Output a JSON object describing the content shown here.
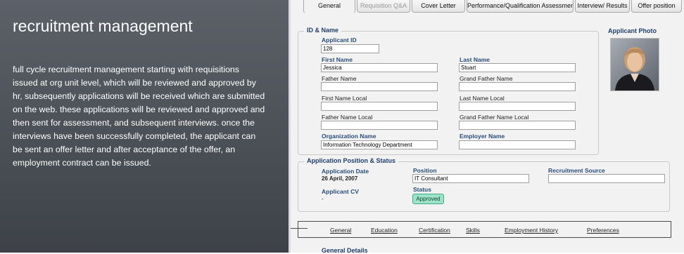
{
  "promo": {
    "title": "recruitment management",
    "description": "full cycle recruitment management starting with requisitions issued at org unit level, which will be reviewed and approved by hr, subsequently applications will be received which are submitted on the web.   these applications will be reviewed and approved and then sent for assessment, and subsequent interviews.  once the interviews have been successfully completed, the applicant can be sent an offer letter and after acceptance of the offer, an employment contract can be issued."
  },
  "tabs": [
    {
      "label": "General",
      "state": "active"
    },
    {
      "label": "Requisition Q&A",
      "state": "disabled"
    },
    {
      "label": "Cover Letter",
      "state": "normal"
    },
    {
      "label": "Performance/Qualification Assessment",
      "state": "normal"
    },
    {
      "label": "Interview/ Results",
      "state": "normal"
    },
    {
      "label": "Offer position",
      "state": "normal"
    }
  ],
  "id_name": {
    "legend": "ID & Name",
    "applicant_id_label": "Applicant ID",
    "applicant_id": "128",
    "first_name_label": "First Name",
    "first_name": "Jessica",
    "last_name_label": "Last Name",
    "last_name": "Stuart",
    "father_name_label": "Father Name",
    "father_name": "",
    "grand_father_name_label": "Grand Father Name",
    "grand_father_name": "",
    "first_name_local_label": "First Name Local",
    "first_name_local": "",
    "last_name_local_label": "Last Name Local",
    "last_name_local": "",
    "father_name_local_label": "Father Name Local",
    "father_name_local": "",
    "grand_father_name_local_label": "Grand Father Name Local",
    "grand_father_name_local": "",
    "organization_name_label": "Organization Name",
    "organization_name": "Information Technology Department",
    "employer_name_label": "Employer Name",
    "employer_name": ""
  },
  "photo": {
    "legend": "Applicant Photo"
  },
  "position_status": {
    "legend": "Application Position & Status",
    "application_date_label": "Application Date",
    "application_date": "26 April, 2007",
    "position_label": "Position",
    "position": "IT Consultant",
    "recruitment_source_label": "Recruitment Source",
    "recruitment_source": "",
    "applicant_cv_label": "Applicant CV",
    "applicant_cv": "-",
    "status_label": "Status",
    "status": "Approved"
  },
  "subnav": [
    "General",
    "Education",
    "Certification",
    "Skills",
    "Employment History",
    "Preferences"
  ],
  "general_details_legend": "General Details",
  "colors": {
    "panel": "#4a4e55",
    "accent_label": "#2a4d7a",
    "status_badge": "#9ee3c9"
  }
}
